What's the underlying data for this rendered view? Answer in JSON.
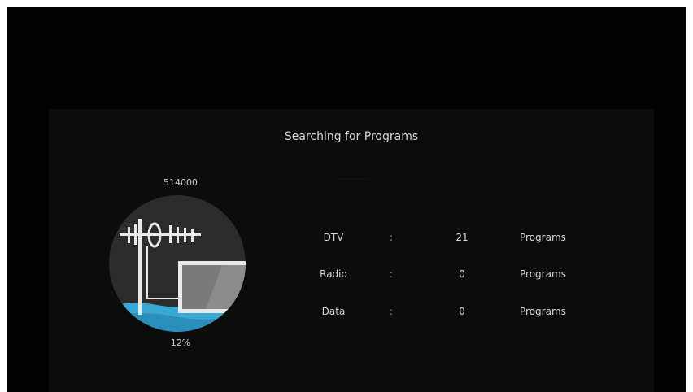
{
  "dialog": {
    "title": "Searching for Programs",
    "frequency": "514000",
    "progress_text": "12%",
    "progress_fraction": 0.12
  },
  "results": [
    {
      "label": "DTV",
      "separator": ":",
      "count": "21",
      "unit": "Programs"
    },
    {
      "label": "Radio",
      "separator": ":",
      "count": "0",
      "unit": "Programs"
    },
    {
      "label": "Data",
      "separator": ":",
      "count": "0",
      "unit": "Programs"
    }
  ],
  "colors": {
    "background": "#020202",
    "panel": "#0c0c0c",
    "illustration_circle": "#2c2c2c",
    "water_accent": "#3aa8d2",
    "screen_gray": "#7a7a7a",
    "text": "#d8d8d8"
  },
  "icons": {
    "illustration": "antenna-tv-icon"
  }
}
